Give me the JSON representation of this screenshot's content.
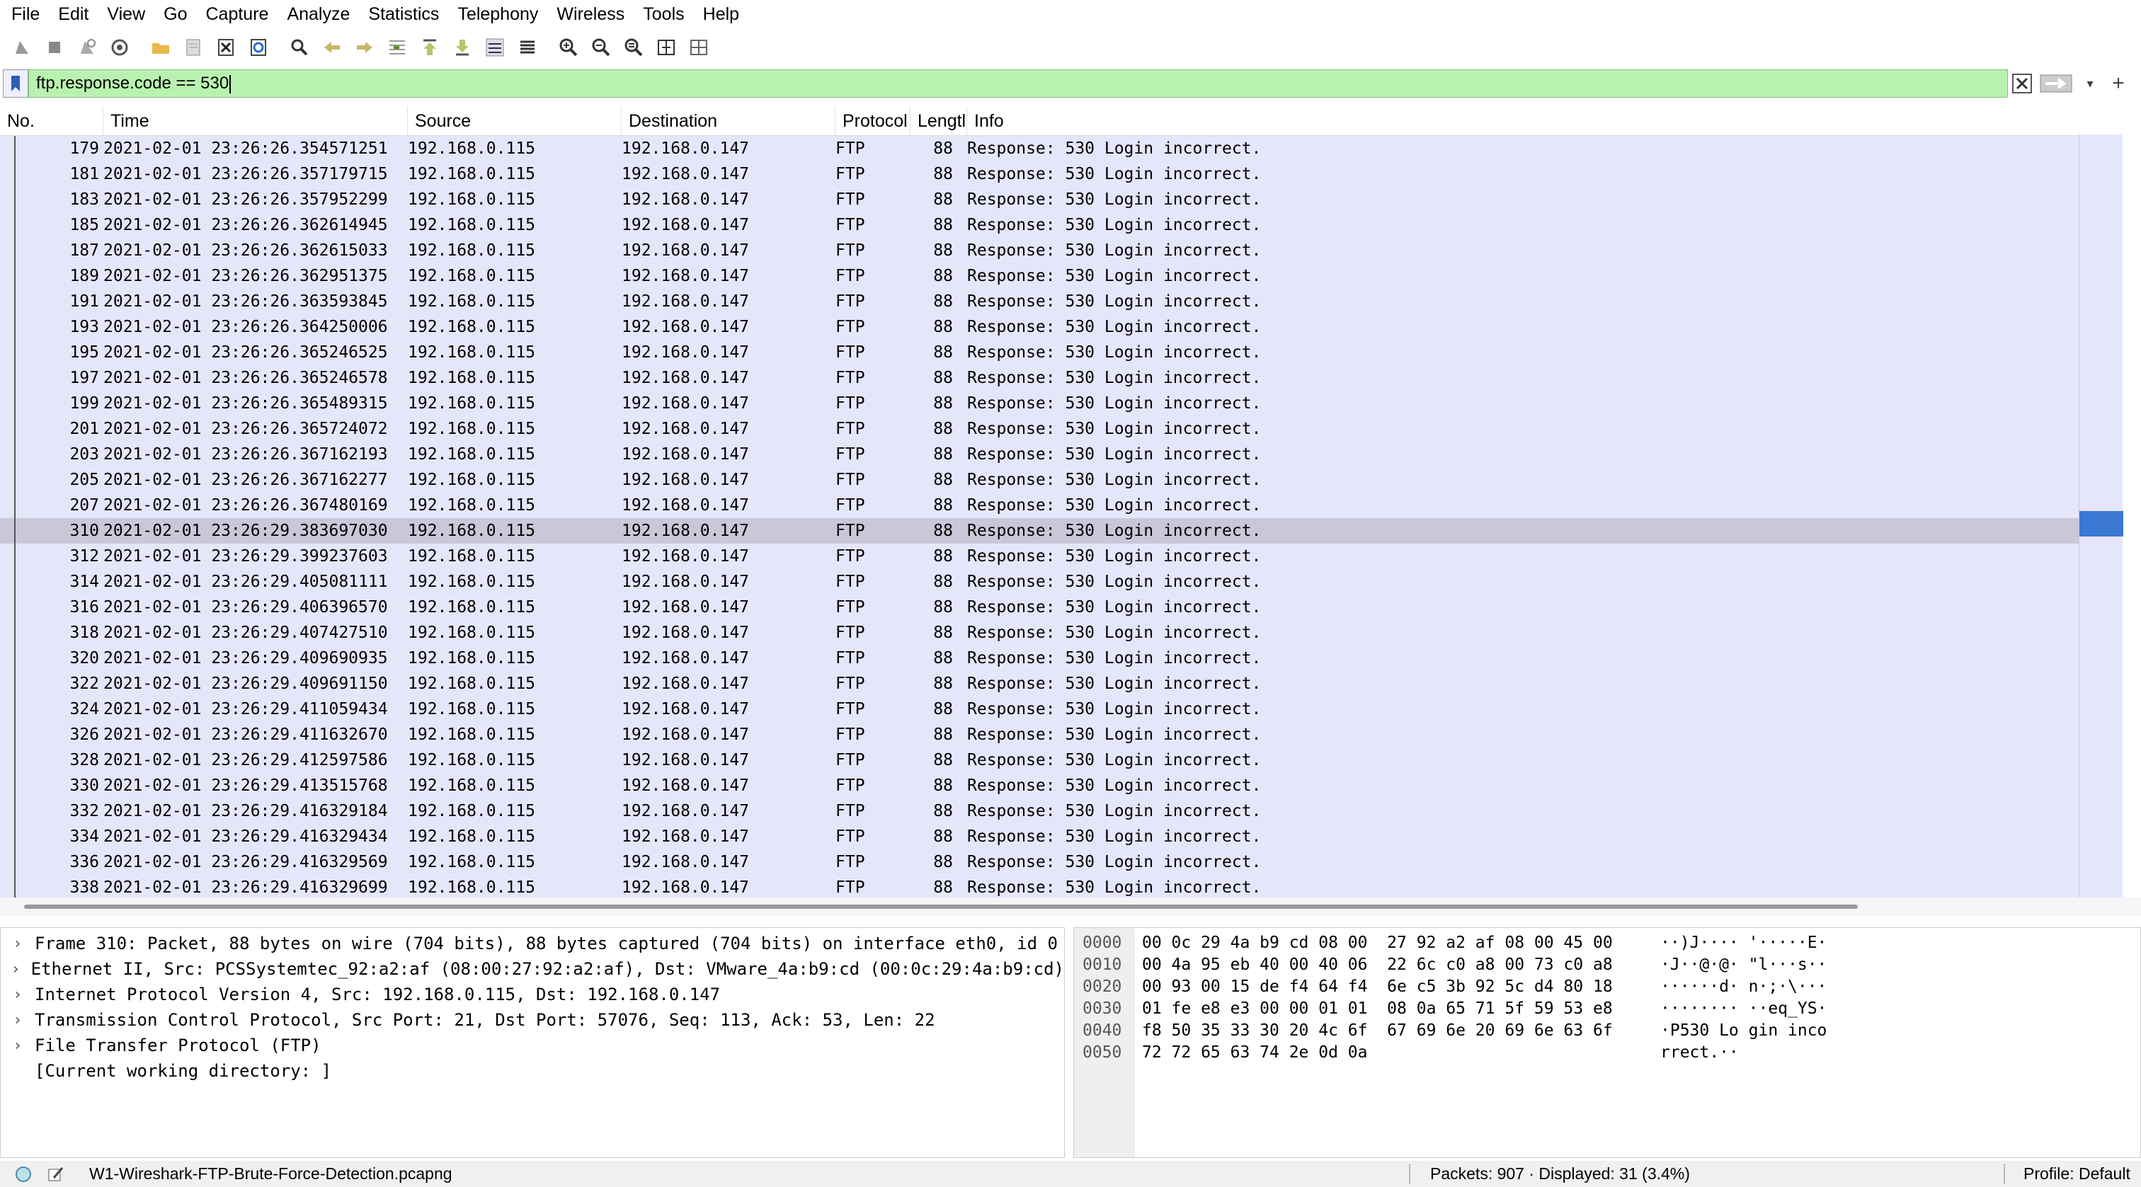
{
  "menu": [
    "File",
    "Edit",
    "View",
    "Go",
    "Capture",
    "Analyze",
    "Statistics",
    "Telephony",
    "Wireless",
    "Tools",
    "Help"
  ],
  "toolbar": {
    "icons": [
      "shark-fin-start-icon",
      "stop-capture-icon",
      "restart-capture-icon",
      "capture-options-icon",
      "open-file-icon",
      "save-file-icon",
      "close-file-icon",
      "reload-file-icon",
      "find-packet-icon",
      "go-back-icon",
      "go-forward-icon",
      "go-to-packet-icon",
      "go-first-icon",
      "go-last-icon",
      "autoscroll-icon",
      "colorize-icon",
      "zoom-in-icon",
      "zoom-out-icon",
      "zoom-normal-icon",
      "resize-columns-icon",
      "layout-icon"
    ]
  },
  "filter": {
    "value": "ftp.response.code == 530"
  },
  "columns": [
    "No.",
    "Time",
    "Source",
    "Destination",
    "Protocol",
    "Lengtl",
    "Info"
  ],
  "rows": [
    {
      "no": "179",
      "time": "2021-02-01 23:26:26.354571251",
      "src": "192.168.0.115",
      "dst": "192.168.0.147",
      "proto": "FTP",
      "len": "88",
      "info": "Response: 530 Login incorrect."
    },
    {
      "no": "181",
      "time": "2021-02-01 23:26:26.357179715",
      "src": "192.168.0.115",
      "dst": "192.168.0.147",
      "proto": "FTP",
      "len": "88",
      "info": "Response: 530 Login incorrect."
    },
    {
      "no": "183",
      "time": "2021-02-01 23:26:26.357952299",
      "src": "192.168.0.115",
      "dst": "192.168.0.147",
      "proto": "FTP",
      "len": "88",
      "info": "Response: 530 Login incorrect."
    },
    {
      "no": "185",
      "time": "2021-02-01 23:26:26.362614945",
      "src": "192.168.0.115",
      "dst": "192.168.0.147",
      "proto": "FTP",
      "len": "88",
      "info": "Response: 530 Login incorrect."
    },
    {
      "no": "187",
      "time": "2021-02-01 23:26:26.362615033",
      "src": "192.168.0.115",
      "dst": "192.168.0.147",
      "proto": "FTP",
      "len": "88",
      "info": "Response: 530 Login incorrect."
    },
    {
      "no": "189",
      "time": "2021-02-01 23:26:26.362951375",
      "src": "192.168.0.115",
      "dst": "192.168.0.147",
      "proto": "FTP",
      "len": "88",
      "info": "Response: 530 Login incorrect."
    },
    {
      "no": "191",
      "time": "2021-02-01 23:26:26.363593845",
      "src": "192.168.0.115",
      "dst": "192.168.0.147",
      "proto": "FTP",
      "len": "88",
      "info": "Response: 530 Login incorrect."
    },
    {
      "no": "193",
      "time": "2021-02-01 23:26:26.364250006",
      "src": "192.168.0.115",
      "dst": "192.168.0.147",
      "proto": "FTP",
      "len": "88",
      "info": "Response: 530 Login incorrect."
    },
    {
      "no": "195",
      "time": "2021-02-01 23:26:26.365246525",
      "src": "192.168.0.115",
      "dst": "192.168.0.147",
      "proto": "FTP",
      "len": "88",
      "info": "Response: 530 Login incorrect."
    },
    {
      "no": "197",
      "time": "2021-02-01 23:26:26.365246578",
      "src": "192.168.0.115",
      "dst": "192.168.0.147",
      "proto": "FTP",
      "len": "88",
      "info": "Response: 530 Login incorrect."
    },
    {
      "no": "199",
      "time": "2021-02-01 23:26:26.365489315",
      "src": "192.168.0.115",
      "dst": "192.168.0.147",
      "proto": "FTP",
      "len": "88",
      "info": "Response: 530 Login incorrect."
    },
    {
      "no": "201",
      "time": "2021-02-01 23:26:26.365724072",
      "src": "192.168.0.115",
      "dst": "192.168.0.147",
      "proto": "FTP",
      "len": "88",
      "info": "Response: 530 Login incorrect."
    },
    {
      "no": "203",
      "time": "2021-02-01 23:26:26.367162193",
      "src": "192.168.0.115",
      "dst": "192.168.0.147",
      "proto": "FTP",
      "len": "88",
      "info": "Response: 530 Login incorrect."
    },
    {
      "no": "205",
      "time": "2021-02-01 23:26:26.367162277",
      "src": "192.168.0.115",
      "dst": "192.168.0.147",
      "proto": "FTP",
      "len": "88",
      "info": "Response: 530 Login incorrect."
    },
    {
      "no": "207",
      "time": "2021-02-01 23:26:26.367480169",
      "src": "192.168.0.115",
      "dst": "192.168.0.147",
      "proto": "FTP",
      "len": "88",
      "info": "Response: 530 Login incorrect."
    },
    {
      "no": "310",
      "time": "2021-02-01 23:26:29.383697030",
      "src": "192.168.0.115",
      "dst": "192.168.0.147",
      "proto": "FTP",
      "len": "88",
      "info": "Response: 530 Login incorrect.",
      "selected": true
    },
    {
      "no": "312",
      "time": "2021-02-01 23:26:29.399237603",
      "src": "192.168.0.115",
      "dst": "192.168.0.147",
      "proto": "FTP",
      "len": "88",
      "info": "Response: 530 Login incorrect."
    },
    {
      "no": "314",
      "time": "2021-02-01 23:26:29.405081111",
      "src": "192.168.0.115",
      "dst": "192.168.0.147",
      "proto": "FTP",
      "len": "88",
      "info": "Response: 530 Login incorrect."
    },
    {
      "no": "316",
      "time": "2021-02-01 23:26:29.406396570",
      "src": "192.168.0.115",
      "dst": "192.168.0.147",
      "proto": "FTP",
      "len": "88",
      "info": "Response: 530 Login incorrect."
    },
    {
      "no": "318",
      "time": "2021-02-01 23:26:29.407427510",
      "src": "192.168.0.115",
      "dst": "192.168.0.147",
      "proto": "FTP",
      "len": "88",
      "info": "Response: 530 Login incorrect."
    },
    {
      "no": "320",
      "time": "2021-02-01 23:26:29.409690935",
      "src": "192.168.0.115",
      "dst": "192.168.0.147",
      "proto": "FTP",
      "len": "88",
      "info": "Response: 530 Login incorrect."
    },
    {
      "no": "322",
      "time": "2021-02-01 23:26:29.409691150",
      "src": "192.168.0.115",
      "dst": "192.168.0.147",
      "proto": "FTP",
      "len": "88",
      "info": "Response: 530 Login incorrect."
    },
    {
      "no": "324",
      "time": "2021-02-01 23:26:29.411059434",
      "src": "192.168.0.115",
      "dst": "192.168.0.147",
      "proto": "FTP",
      "len": "88",
      "info": "Response: 530 Login incorrect."
    },
    {
      "no": "326",
      "time": "2021-02-01 23:26:29.411632670",
      "src": "192.168.0.115",
      "dst": "192.168.0.147",
      "proto": "FTP",
      "len": "88",
      "info": "Response: 530 Login incorrect."
    },
    {
      "no": "328",
      "time": "2021-02-01 23:26:29.412597586",
      "src": "192.168.0.115",
      "dst": "192.168.0.147",
      "proto": "FTP",
      "len": "88",
      "info": "Response: 530 Login incorrect."
    },
    {
      "no": "330",
      "time": "2021-02-01 23:26:29.413515768",
      "src": "192.168.0.115",
      "dst": "192.168.0.147",
      "proto": "FTP",
      "len": "88",
      "info": "Response: 530 Login incorrect."
    },
    {
      "no": "332",
      "time": "2021-02-01 23:26:29.416329184",
      "src": "192.168.0.115",
      "dst": "192.168.0.147",
      "proto": "FTP",
      "len": "88",
      "info": "Response: 530 Login incorrect."
    },
    {
      "no": "334",
      "time": "2021-02-01 23:26:29.416329434",
      "src": "192.168.0.115",
      "dst": "192.168.0.147",
      "proto": "FTP",
      "len": "88",
      "info": "Response: 530 Login incorrect."
    },
    {
      "no": "336",
      "time": "2021-02-01 23:26:29.416329569",
      "src": "192.168.0.115",
      "dst": "192.168.0.147",
      "proto": "FTP",
      "len": "88",
      "info": "Response: 530 Login incorrect."
    },
    {
      "no": "338",
      "time": "2021-02-01 23:26:29.416329699",
      "src": "192.168.0.115",
      "dst": "192.168.0.147",
      "proto": "FTP",
      "len": "88",
      "info": "Response: 530 Login incorrect."
    }
  ],
  "details": [
    {
      "expandable": true,
      "text": "Frame 310: Packet, 88 bytes on wire (704 bits), 88 bytes captured (704 bits) on interface eth0, id 0"
    },
    {
      "expandable": true,
      "text": "Ethernet II, Src: PCSSystemtec_92:a2:af (08:00:27:92:a2:af), Dst: VMware_4a:b9:cd (00:0c:29:4a:b9:cd)"
    },
    {
      "expandable": true,
      "text": "Internet Protocol Version 4, Src: 192.168.0.115, Dst: 192.168.0.147"
    },
    {
      "expandable": true,
      "text": "Transmission Control Protocol, Src Port: 21, Dst Port: 57076, Seq: 113, Ack: 53, Len: 22"
    },
    {
      "expandable": true,
      "text": "File Transfer Protocol (FTP)"
    },
    {
      "expandable": false,
      "text": "[Current working directory: ]"
    }
  ],
  "bytes": [
    {
      "offset": "0000",
      "hex": "00 0c 29 4a b9 cd 08 00  27 92 a2 af 08 00 45 00",
      "ascii": "··)J···· '·····E·"
    },
    {
      "offset": "0010",
      "hex": "00 4a 95 eb 40 00 40 06  22 6c c0 a8 00 73 c0 a8",
      "ascii": "·J··@·@· \"l···s··"
    },
    {
      "offset": "0020",
      "hex": "00 93 00 15 de f4 64 f4  6e c5 3b 92 5c d4 80 18",
      "ascii": "······d· n·;·\\···"
    },
    {
      "offset": "0030",
      "hex": "01 fe e8 e3 00 00 01 01  08 0a 65 71 5f 59 53 e8",
      "ascii": "········ ··eq_YS·"
    },
    {
      "offset": "0040",
      "hex": "f8 50 35 33 30 20 4c 6f  67 69 6e 20 69 6e 63 6f",
      "ascii": "·P530 Lo gin inco"
    },
    {
      "offset": "0050",
      "hex": "72 72 65 63 74 2e 0d 0a",
      "ascii": "rrect.··"
    }
  ],
  "status": {
    "file": "W1-Wireshark-FTP-Brute-Force-Detection.pcapng",
    "packets": "Packets: 907 · Displayed: 31 (3.4%)",
    "profile": "Profile: Default"
  },
  "colors": {
    "row_bg": "#e6e6fb",
    "selected_bg": "#c8c8d8",
    "filter_bg": "#b9f2b0",
    "minimap_mark": "#3b78d4"
  }
}
